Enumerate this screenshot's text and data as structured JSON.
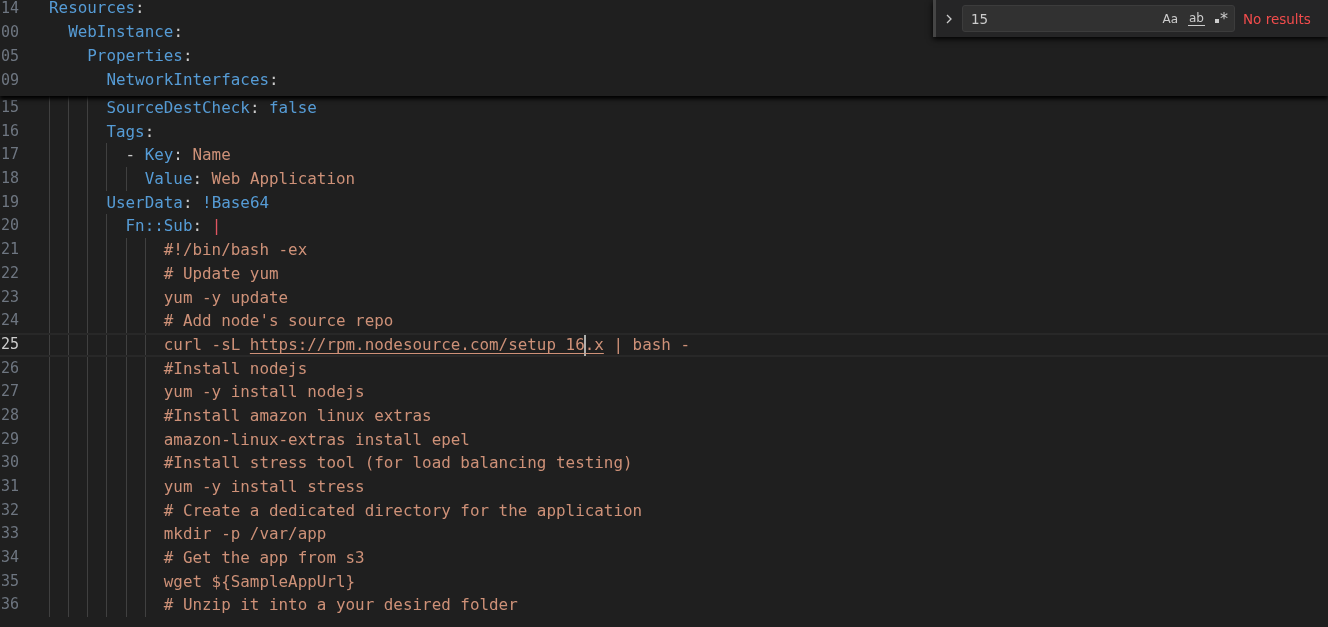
{
  "sticky_lines": [
    {
      "number": "14",
      "tokens": [
        {
          "text": "Resources",
          "kind": "key"
        },
        {
          "text": ":",
          "kind": "punct"
        }
      ],
      "children": [
        {
          "number": "00",
          "tokens": [
            {
              "text": "WebInstance",
              "kind": "key"
            },
            {
              "text": ":",
              "kind": "punct"
            }
          ],
          "children": [
            {
              "number": "05",
              "tokens": [
                {
                  "text": "Properties",
                  "kind": "key"
                },
                {
                  "text": ":",
                  "kind": "punct"
                }
              ],
              "children": [
                {
                  "number": "09",
                  "tokens": [
                    {
                      "text": "NetworkInterfaces",
                      "kind": "key"
                    },
                    {
                      "text": ":",
                      "kind": "punct"
                    }
                  ]
                }
              ]
            }
          ]
        }
      ]
    }
  ],
  "lines": [
    {
      "number": "15",
      "current": false,
      "tokens": [
        {
          "text": "SourceDestCheck",
          "kind": "key"
        },
        {
          "text": ": ",
          "kind": "punct"
        },
        {
          "text": "false",
          "kind": "keyword"
        }
      ]
    },
    {
      "number": "16",
      "current": false,
      "tokens": [
        {
          "text": "Tags",
          "kind": "key"
        },
        {
          "text": ":",
          "kind": "punct"
        }
      ],
      "children": [
        {
          "number": "17",
          "current": false,
          "tokens": [
            {
              "text": "- ",
              "kind": "punct"
            },
            {
              "text": "Key",
              "kind": "key"
            },
            {
              "text": ": ",
              "kind": "punct"
            },
            {
              "text": "Name",
              "kind": "string"
            }
          ],
          "children": [
            {
              "number": "18",
              "current": false,
              "tokens": [
                {
                  "text": "Value",
                  "kind": "key"
                },
                {
                  "text": ": ",
                  "kind": "punct"
                },
                {
                  "text": "Web Application",
                  "kind": "string"
                }
              ]
            }
          ]
        }
      ]
    },
    {
      "number": "19",
      "current": false,
      "tokens": [
        {
          "text": "UserData",
          "kind": "key"
        },
        {
          "text": ": ",
          "kind": "punct"
        },
        {
          "text": "!Base64",
          "kind": "tag"
        }
      ],
      "children": [
        {
          "number": "20",
          "current": false,
          "tokens": [
            {
              "text": "Fn::Sub",
              "kind": "key"
            },
            {
              "text": ": ",
              "kind": "punct"
            },
            {
              "text": "|",
              "kind": "indicator"
            }
          ],
          "children": [
            {
              "number": "21",
              "current": false,
              "tokens": [
                {
                  "text": "#!/bin/bash -ex",
                  "kind": "string"
                }
              ]
            },
            {
              "number": "22",
              "current": false,
              "tokens": [
                {
                  "text": "# Update yum",
                  "kind": "string"
                }
              ]
            },
            {
              "number": "23",
              "current": false,
              "tokens": [
                {
                  "text": "yum -y update",
                  "kind": "string"
                }
              ]
            },
            {
              "number": "24",
              "current": false,
              "tokens": [
                {
                  "text": "# Add node's source repo",
                  "kind": "string"
                }
              ]
            },
            {
              "number": "25",
              "current": true,
              "tokens": [
                {
                  "text": "curl -sL ",
                  "kind": "string"
                },
                {
                  "text": "https://rpm.nodesource.com/setup_16",
                  "kind": "link"
                },
                {
                  "kind": "cursor"
                },
                {
                  "text": ".x",
                  "kind": "link"
                },
                {
                  "text": " | bash -",
                  "kind": "string"
                }
              ]
            },
            {
              "number": "26",
              "current": false,
              "tokens": [
                {
                  "text": "#Install nodejs",
                  "kind": "string"
                }
              ]
            },
            {
              "number": "27",
              "current": false,
              "tokens": [
                {
                  "text": "yum -y install nodejs",
                  "kind": "string"
                }
              ]
            },
            {
              "number": "28",
              "current": false,
              "tokens": [
                {
                  "text": "#Install amazon linux extras",
                  "kind": "string"
                }
              ]
            },
            {
              "number": "29",
              "current": false,
              "tokens": [
                {
                  "text": "amazon-linux-extras install epel",
                  "kind": "string"
                }
              ]
            },
            {
              "number": "30",
              "current": false,
              "tokens": [
                {
                  "text": "#Install stress tool (for load balancing testing)",
                  "kind": "string"
                }
              ]
            },
            {
              "number": "31",
              "current": false,
              "tokens": [
                {
                  "text": "yum -y install stress",
                  "kind": "string"
                }
              ]
            },
            {
              "number": "32",
              "current": false,
              "tokens": [
                {
                  "text": "# Create a dedicated directory for the application",
                  "kind": "string"
                }
              ]
            },
            {
              "number": "33",
              "current": false,
              "tokens": [
                {
                  "text": "mkdir -p /var/app",
                  "kind": "string"
                }
              ]
            },
            {
              "number": "34",
              "current": false,
              "tokens": [
                {
                  "text": "# Get the app from s3",
                  "kind": "string"
                }
              ]
            },
            {
              "number": "35",
              "current": false,
              "tokens": [
                {
                  "text": "wget ${SampleAppUrl}",
                  "kind": "string"
                }
              ]
            },
            {
              "number": "36",
              "current": false,
              "tokens": [
                {
                  "text": "# Unzip it into a your desired folder",
                  "kind": "string"
                }
              ]
            }
          ]
        }
      ]
    }
  ],
  "find": {
    "replace_expanded": false,
    "value": "15",
    "toggles": [
      {
        "label": "Aa",
        "kind": "case",
        "selected": false
      },
      {
        "label": "ab",
        "kind": "word",
        "selected": false
      },
      {
        "label": "*",
        "kind": "regex",
        "selected": false
      }
    ],
    "result": "No results"
  }
}
